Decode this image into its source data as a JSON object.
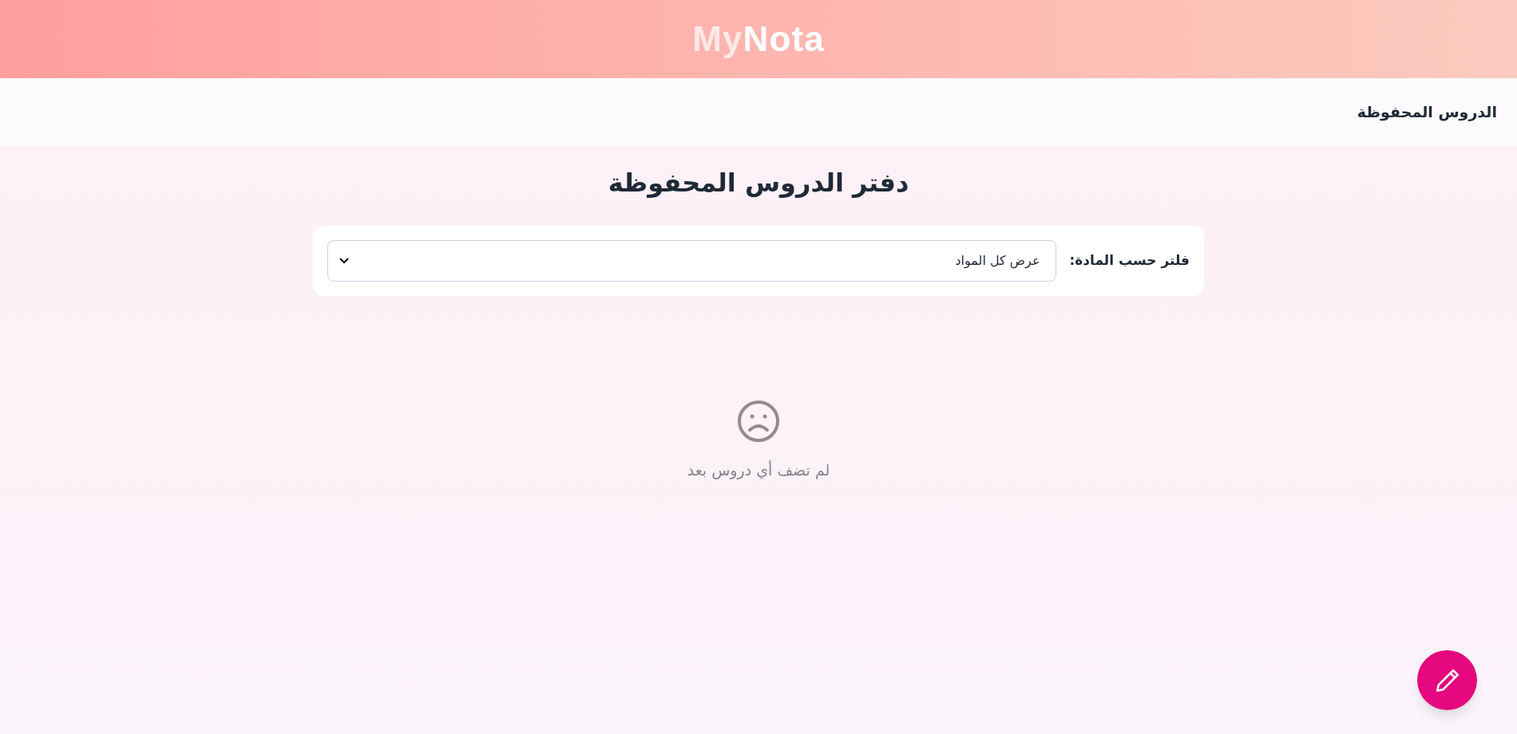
{
  "header": {
    "logo_part_1": "My",
    "logo_part_2": "Nota"
  },
  "nav": {
    "title": "الدروس المحفوظة"
  },
  "page_title": "دفتر الدروس المحفوظة",
  "filter": {
    "label": "فلتر حسب المادة:",
    "value": "عرض كل المواد"
  },
  "empty_state": {
    "message": "لم تضف أي دروس بعد"
  }
}
